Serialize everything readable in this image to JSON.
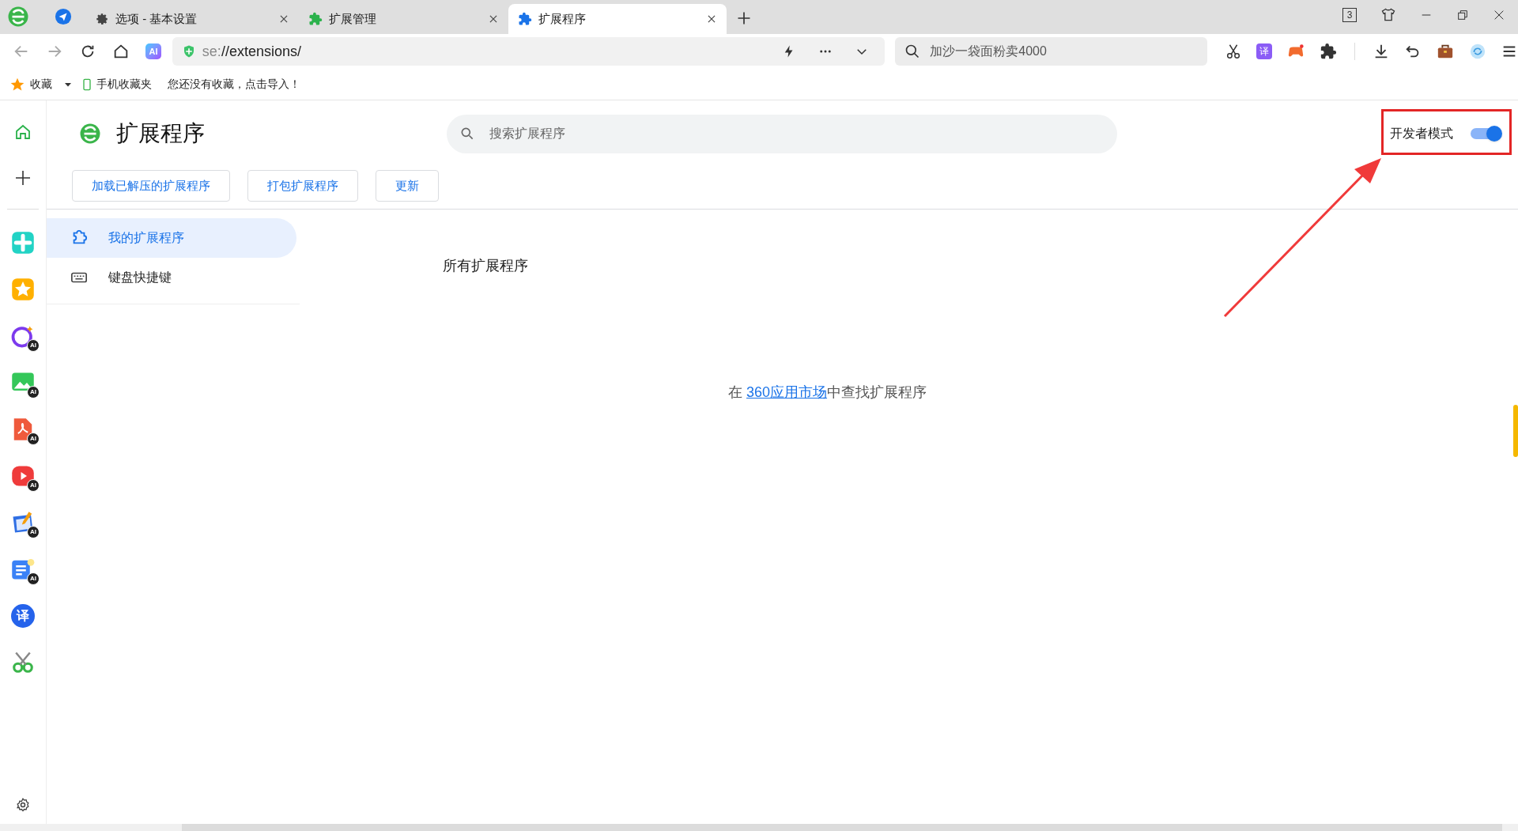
{
  "tabs": [
    {
      "label": "选项 - 基本设置",
      "kind": "settings",
      "selected": false
    },
    {
      "label": "扩展管理",
      "kind": "manager",
      "selected": false
    },
    {
      "label": "扩展程序",
      "kind": "extensions",
      "selected": true
    }
  ],
  "tab_count": "3",
  "address_bar": {
    "scheme": "se:",
    "path": "//extensions/"
  },
  "toolbar_ai_label": "AI",
  "search": {
    "placeholder": "加沙一袋面粉卖4000"
  },
  "toolbar_translate_label": "译",
  "bookmarks_bar": {
    "favorites": "收藏",
    "mobile": "手机收藏夹",
    "empty_hint": "您还没有收藏，点击导入！"
  },
  "rail": [
    {
      "kind": "home"
    },
    {
      "kind": "add"
    },
    {
      "kind": "divider"
    },
    {
      "kind": "plus-app"
    },
    {
      "kind": "star"
    },
    {
      "kind": "ai-ring",
      "badge": "AI"
    },
    {
      "kind": "image",
      "badge": "AI"
    },
    {
      "kind": "pdf",
      "badge": "AI"
    },
    {
      "kind": "video",
      "badge": "AI"
    },
    {
      "kind": "pencil",
      "badge": "AI"
    },
    {
      "kind": "doc",
      "badge": "AI"
    },
    {
      "kind": "translate",
      "glyph": "译"
    },
    {
      "kind": "scissors"
    }
  ],
  "page": {
    "title": "扩展程序",
    "search_placeholder": "搜索扩展程序",
    "developer_mode": {
      "label": "开发者模式",
      "on": true
    },
    "buttons": [
      "加载已解压的扩展程序",
      "打包扩展程序",
      "更新"
    ],
    "sidebar": [
      {
        "label": "我的扩展程序",
        "kind": "extensions",
        "selected": true
      },
      {
        "label": "键盘快捷键",
        "kind": "shortcuts",
        "selected": false
      }
    ],
    "section_heading": "所有扩展程序",
    "empty_message": {
      "before": "在 ",
      "link": "360应用市场",
      "after": "中查找扩展程序"
    }
  }
}
